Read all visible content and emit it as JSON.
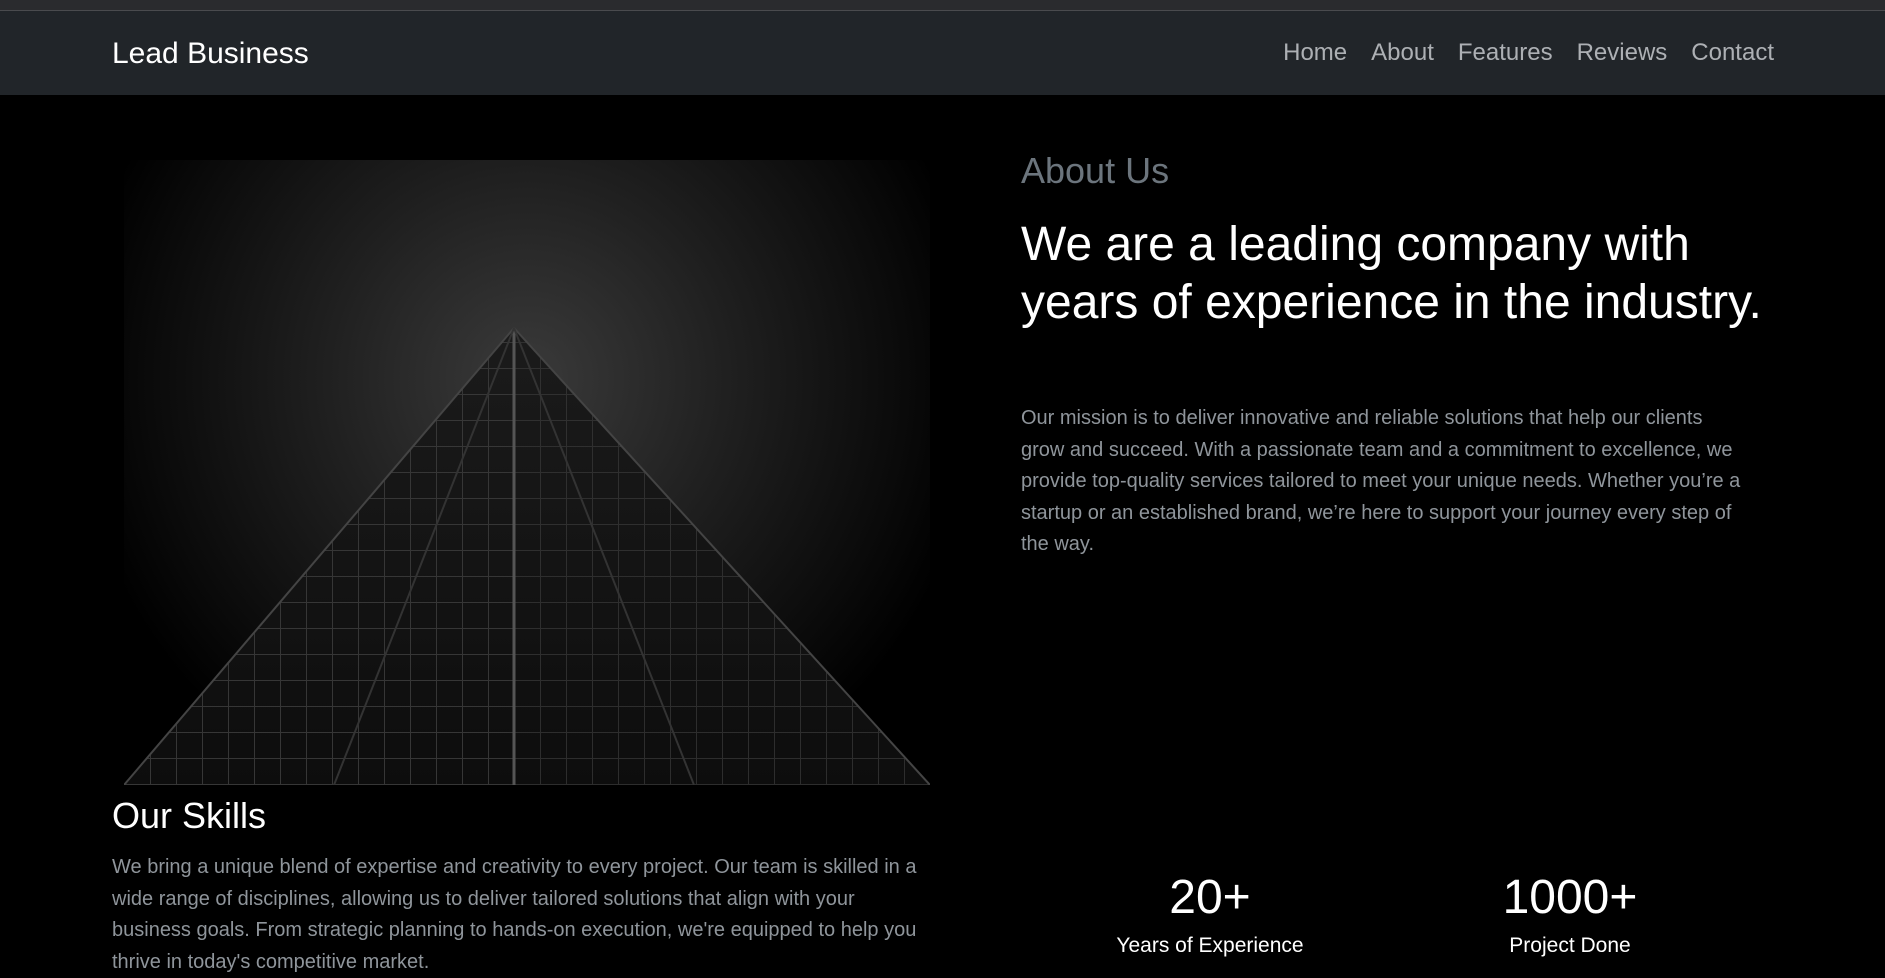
{
  "navbar": {
    "brand": "Lead Business",
    "links": [
      "Home",
      "About",
      "Features",
      "Reviews",
      "Contact"
    ]
  },
  "about": {
    "eyebrow": "About Us",
    "title": "We are a leading company with years of experience in the industry.",
    "text": "Our mission is to deliver innovative and reliable solutions that help our clients grow and succeed. With a passionate team and a commitment to excellence, we provide top-quality services tailored to meet your unique needs. Whether you’re a startup or an established brand, we’re here to support your journey every step of the way."
  },
  "skills": {
    "title": "Our Skills",
    "text": "We bring a unique blend of expertise and creativity to every project. Our team is skilled in a wide range of disciplines, allowing us to deliver tailored solutions that align with your business goals. From strategic planning to hands-on execution, we're equipped to help you thrive in today's competitive market."
  },
  "stats": [
    {
      "number": "20+",
      "label": "Years of Experience"
    },
    {
      "number": "1000+",
      "label": "Project Done"
    }
  ],
  "colors": {
    "background": "#000000",
    "navbar": "#212529",
    "muted_text": "#6c757d",
    "nav_link": "#adb0b4"
  }
}
